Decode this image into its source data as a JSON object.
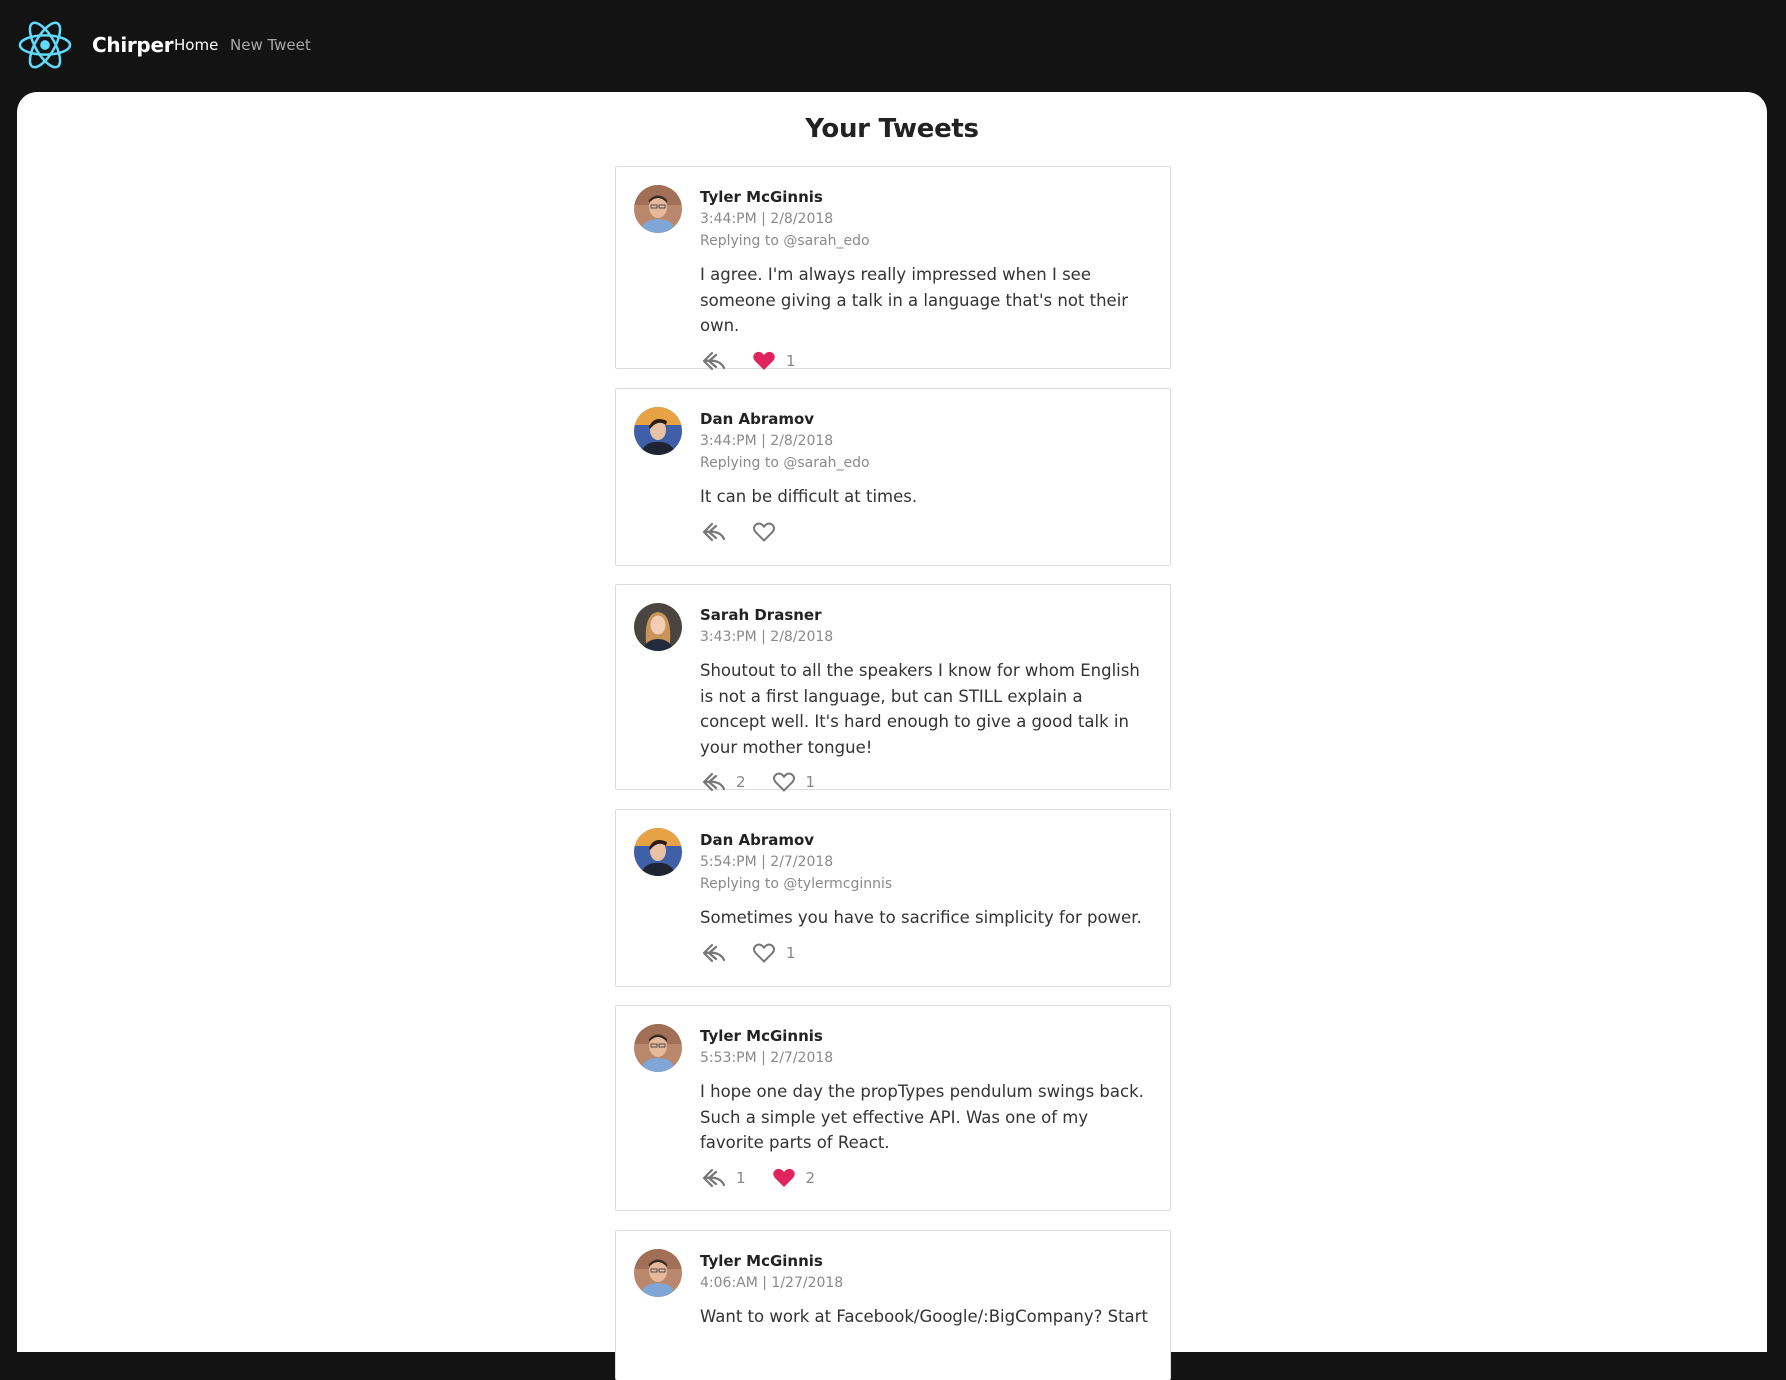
{
  "brand": {
    "name": "Chirper"
  },
  "nav": {
    "home": "Home",
    "new_tweet": "New Tweet"
  },
  "page": {
    "title": "Your Tweets"
  },
  "colors": {
    "liked": "#e0245e",
    "accent": "#61dafb"
  },
  "tweets": [
    {
      "author": "Tyler McGinnis",
      "meta": "3:44:PM | 2/8/2018",
      "reply_to": "Replying to @sarah_edo",
      "text": "I agree. I'm always really impressed when I see someone giving a talk in a language that's not their own.",
      "reply_count": "",
      "like_count": "1",
      "liked": true
    },
    {
      "author": "Dan Abramov",
      "meta": "3:44:PM | 2/8/2018",
      "reply_to": "Replying to @sarah_edo",
      "text": "It can be difficult at times.",
      "reply_count": "",
      "like_count": "",
      "liked": false
    },
    {
      "author": "Sarah Drasner",
      "meta": "3:43:PM | 2/8/2018",
      "reply_to": "",
      "text": "Shoutout to all the speakers I know for whom English is not a first language, but can STILL explain a concept well. It's hard enough to give a good talk in your mother tongue!",
      "reply_count": "2",
      "like_count": "1",
      "liked": false
    },
    {
      "author": "Dan Abramov",
      "meta": "5:54:PM | 2/7/2018",
      "reply_to": "Replying to @tylermcginnis",
      "text": "Sometimes you have to sacrifice simplicity for power.",
      "reply_count": "",
      "like_count": "1",
      "liked": false
    },
    {
      "author": "Tyler McGinnis",
      "meta": "5:53:PM | 2/7/2018",
      "reply_to": "",
      "text": "I hope one day the propTypes pendulum swings back. Such a simple yet effective API. Was one of my favorite parts of React.",
      "reply_count": "1",
      "like_count": "2",
      "liked": true
    },
    {
      "author": "Tyler McGinnis",
      "meta": "4:06:AM | 1/27/2018",
      "reply_to": "",
      "text": "Want to work at Facebook/Google/:BigCompany? Start",
      "reply_count": "",
      "like_count": "",
      "liked": false
    }
  ]
}
